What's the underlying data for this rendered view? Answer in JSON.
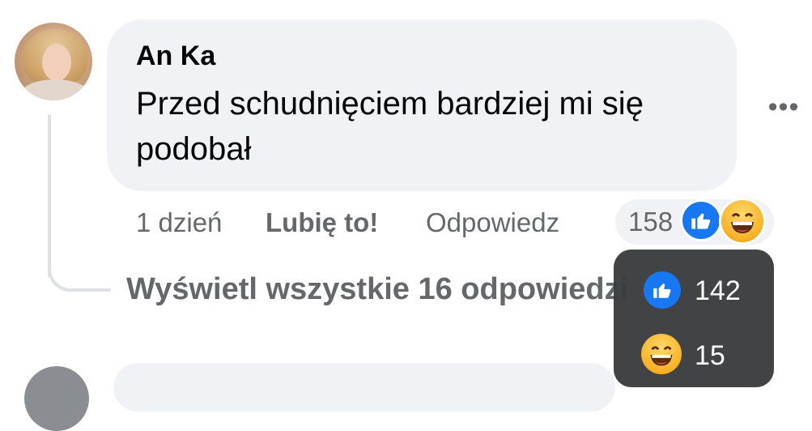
{
  "comment": {
    "author": "An Ka",
    "text": "Przed schudnięciem bardziej mi się podobał",
    "more_icon": "more-horizontal-icon"
  },
  "actions": {
    "time": "1 dzień",
    "like": "Lubię to!",
    "reply": "Odpowiedz"
  },
  "reactions": {
    "total": "158",
    "types": [
      "like",
      "haha"
    ]
  },
  "replies": {
    "view_all": "Wyświetl wszystkie 16 odpowiedzi"
  },
  "tooltip": {
    "like_count": "142",
    "haha_count": "15"
  },
  "colors": {
    "bubble": "#f0f2f5",
    "secondary_text": "#65676b",
    "like_blue": "#1877f2",
    "tooltip_bg": "#3a3b3c"
  }
}
